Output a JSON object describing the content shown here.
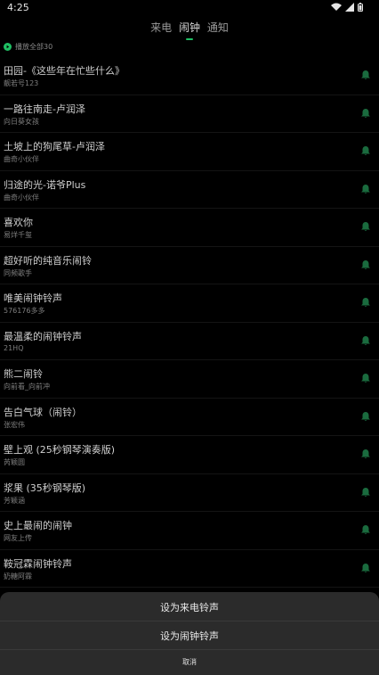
{
  "status": {
    "time": "4:25",
    "icons": [
      "wifi-icon",
      "signal-icon",
      "battery-icon"
    ]
  },
  "tabs": [
    {
      "label": "来电",
      "active": false
    },
    {
      "label": "闹钟",
      "active": true
    },
    {
      "label": "通知",
      "active": false
    }
  ],
  "play_all": {
    "label": "播放全部30"
  },
  "items": [
    {
      "title": "田园-《这些年在忙些什么》",
      "subtitle": "靓若号123"
    },
    {
      "title": "一路往南走-卢润泽",
      "subtitle": "向日葵女孩"
    },
    {
      "title": "土坡上的狗尾草-卢润泽",
      "subtitle": "曲奇小伙伴"
    },
    {
      "title": "归途的光-诺爷Plus",
      "subtitle": "曲奇小伙伴"
    },
    {
      "title": "喜欢你",
      "subtitle": "易烊千玺"
    },
    {
      "title": "超好听的纯音乐闹铃",
      "subtitle": "同频歌手"
    },
    {
      "title": "唯美闹钟铃声",
      "subtitle": "576176多多"
    },
    {
      "title": "最温柔的闹钟铃声",
      "subtitle": "21HQ"
    },
    {
      "title": "熊二闹铃",
      "subtitle": "向前看_向前冲"
    },
    {
      "title": "告白气球（闹铃）",
      "subtitle": "张宏伟"
    },
    {
      "title": "壁上观 (25秒钢琴演奏版)",
      "subtitle": "芮颖圆"
    },
    {
      "title": "浆果 (35秒钢琴版)",
      "subtitle": "芳颖涵"
    },
    {
      "title": "史上最闹的闹钟",
      "subtitle": "网友上传"
    },
    {
      "title": "鞍冠霖闹钟铃声",
      "subtitle": "奶糖阿霖"
    }
  ],
  "sheet": {
    "set_ringtone": "设为来电铃声",
    "set_alarm": "设为闹钟铃声",
    "cancel": "取消"
  },
  "colors": {
    "accent": "#1fbf63",
    "bell": "#1a6b3e",
    "background": "#000000",
    "sheet": "#2b2b2b"
  }
}
